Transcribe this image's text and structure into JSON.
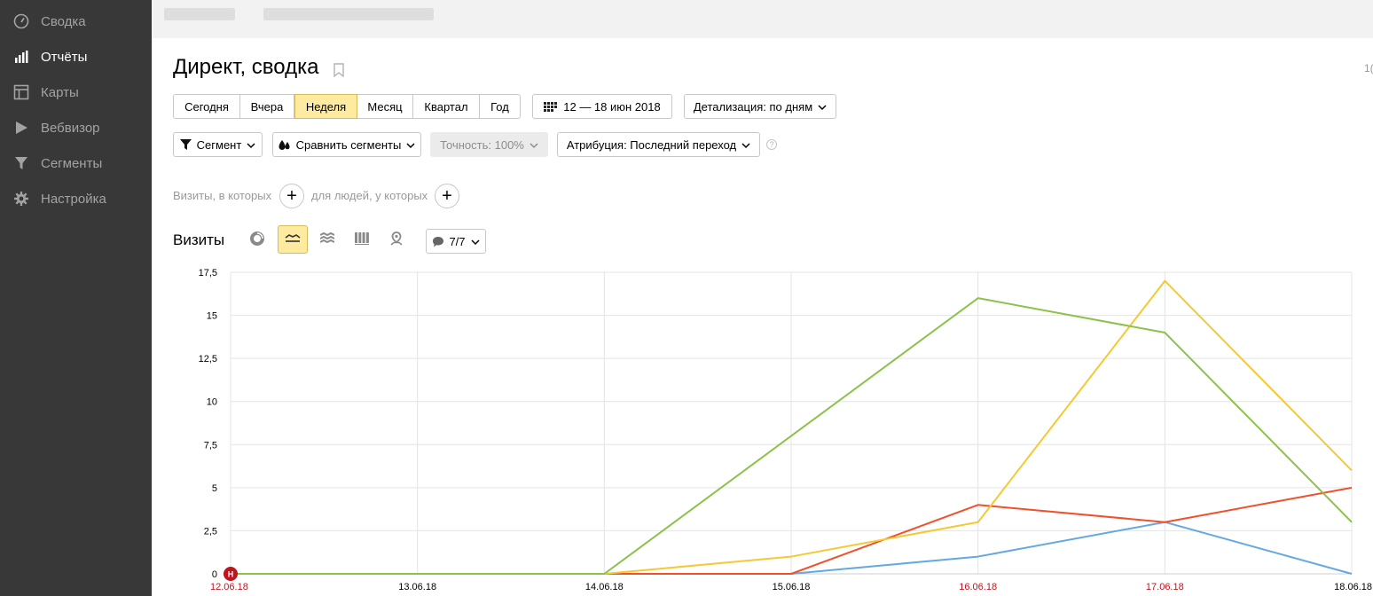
{
  "sidebar": {
    "items": [
      {
        "label": "Сводка",
        "icon": "gauge-icon",
        "active": false
      },
      {
        "label": "Отчёты",
        "icon": "bar-chart-icon",
        "active": true
      },
      {
        "label": "Карты",
        "icon": "map-layout-icon",
        "active": false
      },
      {
        "label": "Вебвизор",
        "icon": "play-icon",
        "active": false
      },
      {
        "label": "Сегменты",
        "icon": "filter-icon",
        "active": false
      },
      {
        "label": "Настройка",
        "icon": "gear-icon",
        "active": false
      }
    ]
  },
  "page": {
    "title": "Директ, сводка",
    "edge_text": "1("
  },
  "period": {
    "options": [
      "Сегодня",
      "Вчера",
      "Неделя",
      "Месяц",
      "Квартал",
      "Год"
    ],
    "selected": "Неделя",
    "date_range": "12 — 18 июн 2018",
    "detail": "Детализация: по дням"
  },
  "toolbar": {
    "segment": "Сегмент",
    "compare": "Сравнить сегменты",
    "accuracy": "Точность: 100%",
    "attribution": "Атрибуция: Последний переход",
    "help": "?"
  },
  "filter": {
    "visits_label": "Визиты, в которых",
    "people_label": "для людей, у которых",
    "plus": "+"
  },
  "chart_header": {
    "title": "Визиты",
    "counter": "7/7"
  },
  "colors": {
    "active_segment": "#ffeba0",
    "green": "#8bc34a",
    "yellow": "#f5c932",
    "red": "#f0502c",
    "blue": "#64a8e0",
    "weekend_red": "#c0141e"
  },
  "chart_data": {
    "type": "line",
    "x": [
      "12.06.18",
      "13.06.18",
      "14.06.18",
      "15.06.18",
      "16.06.18",
      "17.06.18",
      "18.06.18"
    ],
    "weekend": [
      false,
      false,
      false,
      false,
      true,
      true,
      false
    ],
    "y_ticks": [
      "0",
      "2,5",
      "5",
      "7,5",
      "10",
      "12,5",
      "15",
      "17,5"
    ],
    "ylim": [
      0,
      17.5
    ],
    "grid": true,
    "marker": {
      "label": "Н",
      "x_index": 0
    },
    "series": [
      {
        "color": "#8bc34a",
        "values": [
          0,
          0,
          0,
          8,
          16,
          14,
          3
        ]
      },
      {
        "color": "#f5c932",
        "values": [
          0,
          0,
          0,
          1,
          3,
          17,
          6
        ]
      },
      {
        "color": "#f0502c",
        "values": [
          0,
          0,
          0,
          0,
          4,
          3,
          5
        ]
      },
      {
        "color": "#64a8e0",
        "values": [
          0,
          0,
          0,
          0,
          1,
          3,
          0
        ]
      }
    ]
  }
}
